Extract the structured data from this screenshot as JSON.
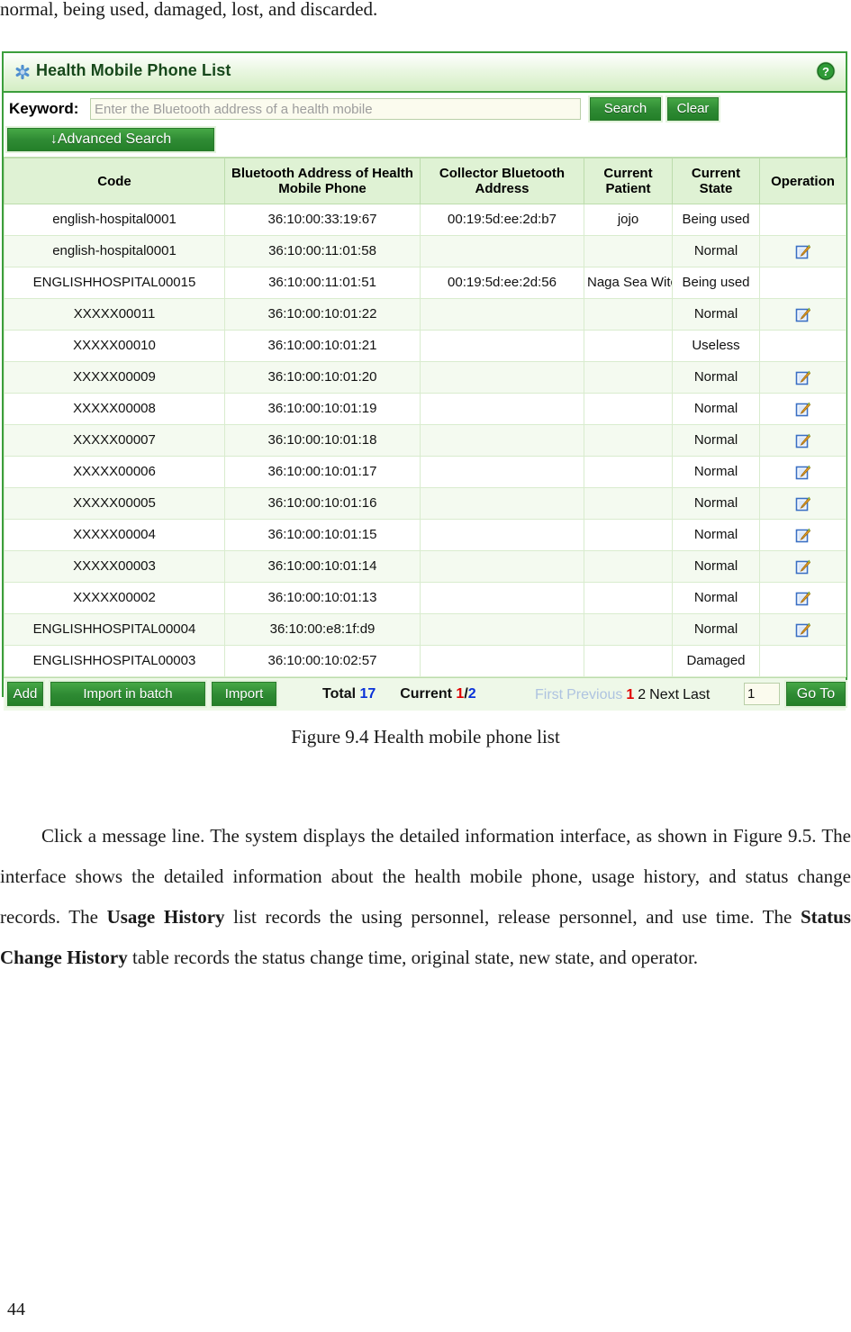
{
  "document": {
    "top_paragraph": "normal, being used, damaged, lost, and discarded.",
    "figure_caption": "Figure 9.4 Health mobile phone list",
    "body_paragraph_html": "Click a message line. The system displays the detailed information interface, as shown in Figure 9.5. The interface shows the detailed information about the health mobile phone, usage history, and status change records. The <b>Usage History</b> list records the using personnel, release personnel, and use time. The <b>Status Change History</b> table records the status change time, original state, new state, and operator.",
    "page_number": "44"
  },
  "panel": {
    "title": "Health Mobile Phone List",
    "title_icon": "asterisk-icon",
    "help_icon": "help-circle-icon",
    "search": {
      "keyword_label": "Keyword:",
      "keyword_value": "",
      "keyword_placeholder": "Enter the Bluetooth address of a health mobile",
      "search_button": "Search",
      "clear_button": "Clear",
      "advanced_button": "↓Advanced Search"
    },
    "table": {
      "columns": [
        "Code",
        "Bluetooth Address of Health Mobile Phone",
        "Collector Bluetooth Address",
        "Current Patient",
        "Current State",
        "Operation"
      ],
      "rows": [
        {
          "code": "english-hospital0001",
          "bluetooth": "36:10:00:33:19:67",
          "collector": "00:19:5d:ee:2d:b7",
          "patient": "jojo",
          "state": "Being used",
          "edit": false
        },
        {
          "code": "english-hospital0001",
          "bluetooth": "36:10:00:11:01:58",
          "collector": "",
          "patient": "",
          "state": "Normal",
          "edit": true
        },
        {
          "code": "ENGLISHHOSPITAL00015",
          "bluetooth": "36:10:00:11:01:51",
          "collector": "00:19:5d:ee:2d:56",
          "patient": "Naga Sea Witch",
          "state": "Being used",
          "edit": false
        },
        {
          "code": "XXXXX00011",
          "bluetooth": "36:10:00:10:01:22",
          "collector": "",
          "patient": "",
          "state": "Normal",
          "edit": true
        },
        {
          "code": "XXXXX00010",
          "bluetooth": "36:10:00:10:01:21",
          "collector": "",
          "patient": "",
          "state": "Useless",
          "edit": false
        },
        {
          "code": "XXXXX00009",
          "bluetooth": "36:10:00:10:01:20",
          "collector": "",
          "patient": "",
          "state": "Normal",
          "edit": true
        },
        {
          "code": "XXXXX00008",
          "bluetooth": "36:10:00:10:01:19",
          "collector": "",
          "patient": "",
          "state": "Normal",
          "edit": true
        },
        {
          "code": "XXXXX00007",
          "bluetooth": "36:10:00:10:01:18",
          "collector": "",
          "patient": "",
          "state": "Normal",
          "edit": true
        },
        {
          "code": "XXXXX00006",
          "bluetooth": "36:10:00:10:01:17",
          "collector": "",
          "patient": "",
          "state": "Normal",
          "edit": true
        },
        {
          "code": "XXXXX00005",
          "bluetooth": "36:10:00:10:01:16",
          "collector": "",
          "patient": "",
          "state": "Normal",
          "edit": true
        },
        {
          "code": "XXXXX00004",
          "bluetooth": "36:10:00:10:01:15",
          "collector": "",
          "patient": "",
          "state": "Normal",
          "edit": true
        },
        {
          "code": "XXXXX00003",
          "bluetooth": "36:10:00:10:01:14",
          "collector": "",
          "patient": "",
          "state": "Normal",
          "edit": true
        },
        {
          "code": "XXXXX00002",
          "bluetooth": "36:10:00:10:01:13",
          "collector": "",
          "patient": "",
          "state": "Normal",
          "edit": true
        },
        {
          "code": "ENGLISHHOSPITAL00004",
          "bluetooth": "36:10:00:e8:1f:d9",
          "collector": "",
          "patient": "",
          "state": "Normal",
          "edit": true
        },
        {
          "code": "ENGLISHHOSPITAL00003",
          "bluetooth": "36:10:00:10:02:57",
          "collector": "",
          "patient": "",
          "state": "Damaged",
          "edit": false
        }
      ]
    },
    "footer": {
      "add_button": "Add",
      "import_batch_button": "Import in batch",
      "import_button": "Import",
      "total_label": "Total",
      "total_value": "17",
      "current_label": "Current",
      "current_page": "1",
      "current_separator": "/",
      "total_pages": "2",
      "pager": {
        "first": "First",
        "previous": "Previous",
        "page_1": "1",
        "page_2": "2",
        "next": "Next",
        "last": "Last"
      },
      "goto_value": "1",
      "goto_button": "Go To"
    }
  },
  "colors": {
    "accent_green": "#2f8b34",
    "border_green": "#3c9e3c",
    "header_green": "#dff2d4",
    "row_alt": "#f4faf0",
    "link_blue": "#0a32d8",
    "current_red": "#e10000",
    "disabled_link": "#aec3e0"
  }
}
